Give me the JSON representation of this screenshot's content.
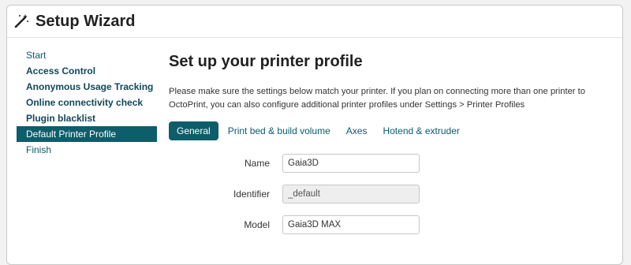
{
  "header": {
    "title": "Setup Wizard",
    "icon": "magic-wand-icon"
  },
  "sidebar": {
    "items": [
      {
        "label": "Start",
        "bold": false,
        "active": false
      },
      {
        "label": "Access Control",
        "bold": true,
        "active": false
      },
      {
        "label": "Anonymous Usage Tracking",
        "bold": true,
        "active": false
      },
      {
        "label": "Online connectivity check",
        "bold": true,
        "active": false
      },
      {
        "label": "Plugin blacklist",
        "bold": true,
        "active": false
      },
      {
        "label": "Default Printer Profile",
        "bold": false,
        "active": true
      },
      {
        "label": "Finish",
        "bold": false,
        "active": false
      }
    ]
  },
  "main": {
    "title": "Set up your printer profile",
    "description": "Please make sure the settings below match your printer. If you plan on connecting more than one printer to OctoPrint, you can also configure additional printer profiles under Settings > Printer Profiles",
    "tabs": [
      {
        "label": "General",
        "active": true
      },
      {
        "label": "Print bed & build volume",
        "active": false
      },
      {
        "label": "Axes",
        "active": false
      },
      {
        "label": "Hotend & extruder",
        "active": false
      }
    ],
    "fields": {
      "name": {
        "label": "Name",
        "value": "Gaia3D"
      },
      "identifier": {
        "label": "Identifier",
        "value": "_default"
      },
      "model": {
        "label": "Model",
        "value": "Gaia3D MAX"
      }
    }
  },
  "colors": {
    "accent": "#0e5d6a",
    "link": "#0b5b6e"
  }
}
